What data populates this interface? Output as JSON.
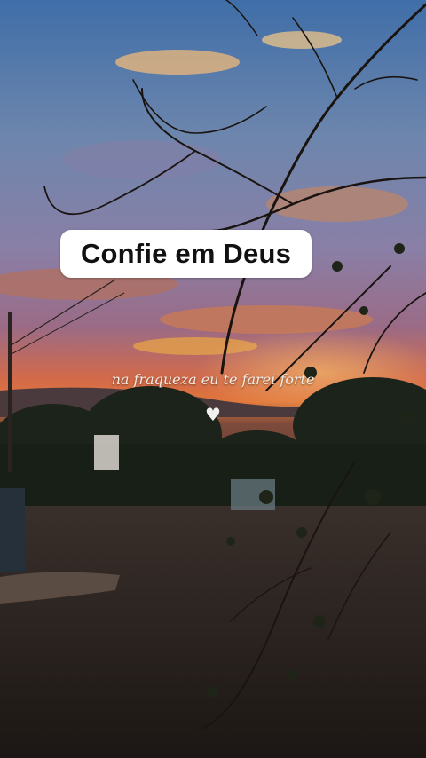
{
  "title": "Confie em Deus",
  "subtitle": "na fraqueza eu te farei forte",
  "heart_icon": "white-heart-icon",
  "colors": {
    "sky_top": "#3f6ea8",
    "sky_mid": "#8a7fa6",
    "sunset": "#e0753a",
    "ground": "#2a221d",
    "pill_bg": "#ffffff",
    "title_text": "#111111"
  }
}
